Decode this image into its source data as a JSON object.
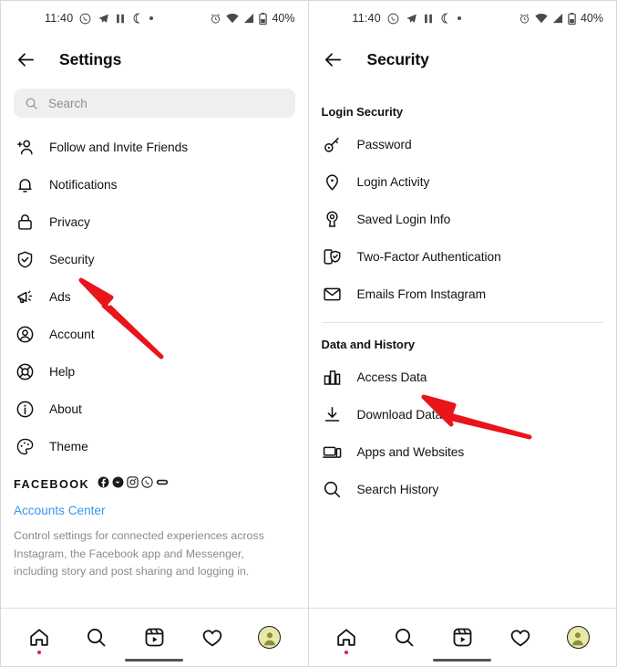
{
  "status_bar": {
    "time": "11:40",
    "battery": "40%",
    "left_icons": [
      "whatsapp-icon",
      "telegram-icon",
      "pause-icon",
      "moon-icon",
      "dot-icon"
    ],
    "right_icons": [
      "alarm-icon",
      "wifi-icon",
      "signal-icon",
      "battery-icon"
    ]
  },
  "left_panel": {
    "header": {
      "title": "Settings",
      "back_icon": "back-arrow-icon"
    },
    "search": {
      "placeholder": "Search",
      "value": "",
      "icon": "search-icon"
    },
    "items": [
      {
        "label": "Follow and Invite Friends",
        "icon": "add-person-icon"
      },
      {
        "label": "Notifications",
        "icon": "bell-icon"
      },
      {
        "label": "Privacy",
        "icon": "lock-icon"
      },
      {
        "label": "Security",
        "icon": "shield-check-icon"
      },
      {
        "label": "Ads",
        "icon": "megaphone-icon"
      },
      {
        "label": "Account",
        "icon": "account-circle-icon"
      },
      {
        "label": "Help",
        "icon": "lifebuoy-icon"
      },
      {
        "label": "About",
        "icon": "info-circle-icon"
      },
      {
        "label": "Theme",
        "icon": "palette-icon"
      }
    ],
    "facebook_block": {
      "title": "FACEBOOK",
      "brand_icons": [
        "facebook-icon",
        "messenger-icon",
        "instagram-icon",
        "whatsapp-icon",
        "portal-icon"
      ],
      "link": "Accounts Center",
      "description": "Control settings for connected experiences across Instagram, the Facebook app and Messenger, including story and post sharing and logging in."
    }
  },
  "right_panel": {
    "header": {
      "title": "Security",
      "back_icon": "back-arrow-icon"
    },
    "sections": [
      {
        "title": "Login Security",
        "items": [
          {
            "label": "Password",
            "icon": "key-icon"
          },
          {
            "label": "Login Activity",
            "icon": "location-pin-icon"
          },
          {
            "label": "Saved Login Info",
            "icon": "keyhole-icon"
          },
          {
            "label": "Two-Factor Authentication",
            "icon": "two-factor-shield-icon"
          },
          {
            "label": "Emails From Instagram",
            "icon": "envelope-icon"
          }
        ]
      },
      {
        "title": "Data and History",
        "items": [
          {
            "label": "Access Data",
            "icon": "bar-chart-icon"
          },
          {
            "label": "Download Data",
            "icon": "download-icon"
          },
          {
            "label": "Apps and Websites",
            "icon": "devices-icon"
          },
          {
            "label": "Search History",
            "icon": "search-icon"
          }
        ]
      }
    ]
  },
  "bottom_nav": {
    "items": [
      {
        "icon": "home-icon",
        "badge_dot": true
      },
      {
        "icon": "search-icon",
        "badge_dot": false
      },
      {
        "icon": "reels-icon",
        "badge_dot": false
      },
      {
        "icon": "heart-icon",
        "badge_dot": false
      },
      {
        "icon": "profile-avatar",
        "badge_dot": false
      }
    ]
  },
  "annotations": {
    "arrow_color": "#e8151b",
    "arrows": [
      {
        "name": "arrow-pointing-security",
        "target": "Security"
      },
      {
        "name": "arrow-pointing-access-data",
        "target": "Access Data"
      }
    ]
  }
}
